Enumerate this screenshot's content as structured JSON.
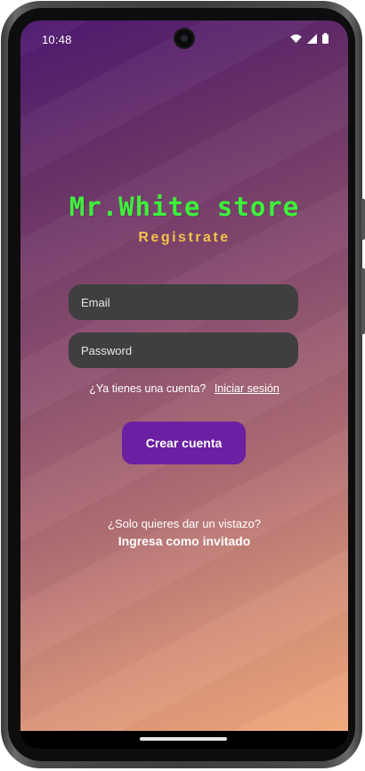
{
  "status_bar": {
    "time": "10:48",
    "icons": [
      "wifi-icon",
      "signal-icon",
      "battery-icon"
    ]
  },
  "app": {
    "title": "Mr.White store",
    "subtitle": "Registrate"
  },
  "form": {
    "email_placeholder": "Email",
    "password_placeholder": "Password",
    "has_account_text": "¿Ya tienes una cuenta?",
    "login_link": "Iniciar sesión",
    "create_button": "Crear cuenta"
  },
  "guest": {
    "question": "¿Solo quieres dar un vistazo?",
    "link": "Ingresa como invitado"
  },
  "colors": {
    "title": "#3df23a",
    "subtitle": "#f3c24a",
    "button": "#6b1fa2",
    "field_bg": "#3f3f3f",
    "gradient_top": "#4e1870",
    "gradient_bottom": "#f1a77a"
  }
}
